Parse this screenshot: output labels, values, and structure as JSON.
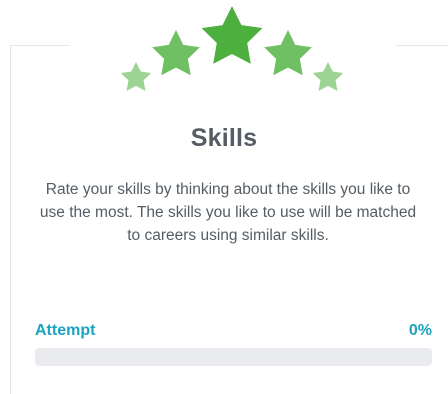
{
  "card": {
    "title": "Skills",
    "description": "Rate your skills by thinking about the skills you like to use the most. The skills you like to use will be matched to careers using similar skills.",
    "progress": {
      "label": "Attempt",
      "value_text": "0%",
      "fraction": 0
    }
  },
  "colors": {
    "accent": "#1aa3bf",
    "star_dark": "#4caf3e",
    "star_mid": "#6fc063",
    "star_light": "#9dd493",
    "text": "#555c63"
  },
  "icons": {
    "emblem": "stars-rating-icon"
  }
}
